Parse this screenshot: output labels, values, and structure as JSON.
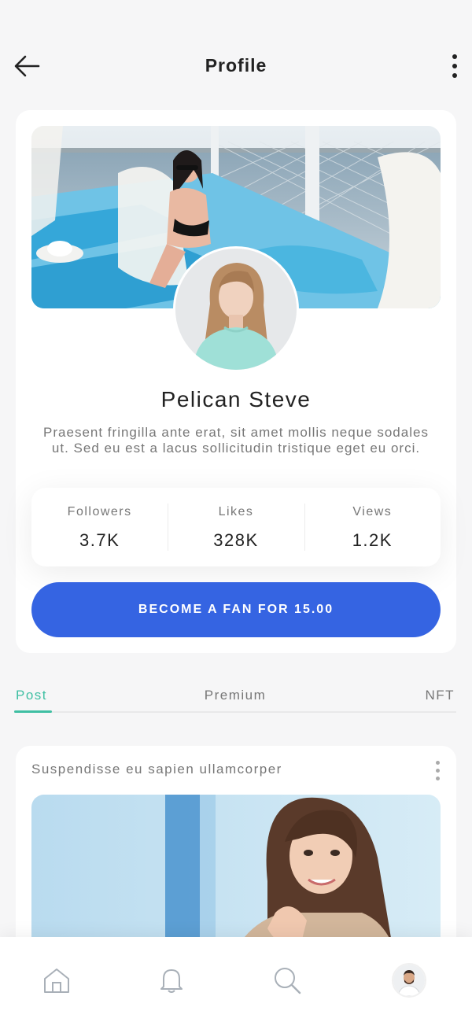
{
  "header": {
    "title": "Profile",
    "back_icon": "arrow-left-icon",
    "more_icon": "more-vertical-icon"
  },
  "profile": {
    "name": "Pelican Steve",
    "bio": "Praesent fringilla ante erat, sit amet mollis neque sodales ut. Sed eu est a lacus sollicitudin tristique eget eu orci.",
    "stats": [
      {
        "label": "Followers",
        "value": "3.7K"
      },
      {
        "label": "Likes",
        "value": "328K"
      },
      {
        "label": "Views",
        "value": "1.2K"
      }
    ],
    "fan_button_label": "BECOME A FAN FOR 15.00"
  },
  "tabs": {
    "items": [
      {
        "label": "Post",
        "active": true
      },
      {
        "label": "Premium",
        "active": false
      },
      {
        "label": "NFT",
        "active": false
      }
    ]
  },
  "post": {
    "title": "Suspendisse eu sapien ullamcorper"
  },
  "bottom_nav": {
    "items": [
      "home-icon",
      "bell-icon",
      "search-icon",
      "profile-avatar"
    ]
  },
  "colors": {
    "accent_blue": "#3564e2",
    "accent_teal": "#3fbfa3",
    "background": "#f6f6f7"
  }
}
